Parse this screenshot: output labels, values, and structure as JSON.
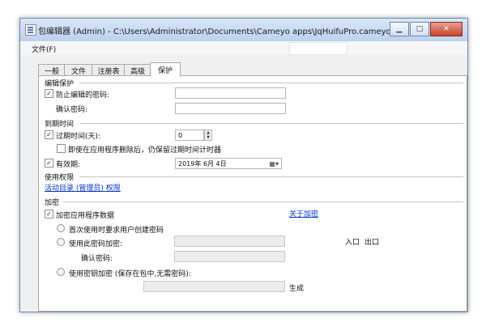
{
  "window": {
    "title": "包编辑器 (Admin) - C:\\Users\\Administrator\\Documents\\Cameyo apps\\JqHuifuPro.cameyo.exe"
  },
  "menu": {
    "file": "文件(F)"
  },
  "tabs": [
    "一般",
    "文件",
    "注册表",
    "高级",
    "保护"
  ],
  "active_tab": "保护",
  "edit_protection": {
    "section_title": "编辑保护",
    "prevent_label": "防止编辑的密码:",
    "prevent_checked": true,
    "confirm_label": "确认密码:"
  },
  "expiration": {
    "section_title": "到期时间",
    "expire_label": "过期时间(天):",
    "expire_checked": true,
    "expire_value": "0",
    "keep_label": "即使在应用程序删除后，仍保留过期时间计时器",
    "keep_checked": false,
    "valid_label": "有效期:",
    "valid_checked": true,
    "date_value": "2019年  6月  4日"
  },
  "usage": {
    "section_title": "使用权限",
    "link": "活动目录 (管理员) 权限"
  },
  "encryption": {
    "section_title": "加密",
    "encrypt_label": "加密应用程序数据",
    "encrypt_checked": true,
    "about_link": "关于加密",
    "opt1": "首次使用时要求用户创建密码",
    "opt2": "使用此密码加密:",
    "confirm_label": "确认密码:",
    "opt3": "使用密钥加密 (保存在包中,无需密码):",
    "import_label": "入口",
    "export_label": "出口",
    "generate_label": "生成"
  },
  "check_glyph": "✓"
}
